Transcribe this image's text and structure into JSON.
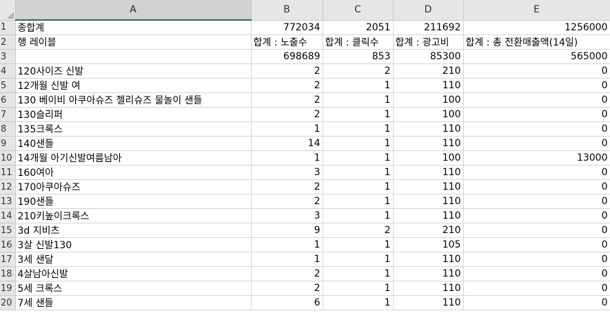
{
  "columns": [
    "A",
    "B",
    "C",
    "D",
    "E"
  ],
  "rows": [
    {
      "n": "1",
      "cells": [
        "종합계",
        "772034",
        "2051",
        "211692",
        "1256000"
      ]
    },
    {
      "n": "2",
      "cells": [
        "행 레이블",
        "합계 : 노출수",
        "합계 : 클릭수",
        "합계 : 광고비",
        "합계 : 총 전환매출액(14일)"
      ]
    },
    {
      "n": "3",
      "cells": [
        "",
        "698689",
        "853",
        "85300",
        "565000"
      ]
    },
    {
      "n": "4",
      "cells": [
        "120사이즈 신발",
        "2",
        "2",
        "210",
        "0"
      ]
    },
    {
      "n": "5",
      "cells": [
        "12개월 신발 여",
        "2",
        "1",
        "110",
        "0"
      ]
    },
    {
      "n": "6",
      "cells": [
        "130 베이비 아쿠아슈즈 젤리슈즈 물놀이 샌들",
        "2",
        "1",
        "100",
        "0"
      ]
    },
    {
      "n": "7",
      "cells": [
        "130슬리퍼",
        "2",
        "1",
        "100",
        "0"
      ]
    },
    {
      "n": "8",
      "cells": [
        "135크록스",
        "1",
        "1",
        "110",
        "0"
      ]
    },
    {
      "n": "9",
      "cells": [
        "140샌들",
        "14",
        "1",
        "110",
        "0"
      ]
    },
    {
      "n": "10",
      "cells": [
        "14개월 아기신발여름남아",
        "1",
        "1",
        "100",
        "13000"
      ]
    },
    {
      "n": "11",
      "cells": [
        "160여아",
        "3",
        "1",
        "110",
        "0"
      ]
    },
    {
      "n": "12",
      "cells": [
        "170아쿠아슈즈",
        "2",
        "1",
        "110",
        "0"
      ]
    },
    {
      "n": "13",
      "cells": [
        "190샌들",
        "2",
        "1",
        "110",
        "0"
      ]
    },
    {
      "n": "14",
      "cells": [
        "210키높이크록스",
        "3",
        "1",
        "110",
        "0"
      ]
    },
    {
      "n": "15",
      "cells": [
        "3d 지비츠",
        "9",
        "2",
        "210",
        "0"
      ]
    },
    {
      "n": "16",
      "cells": [
        "3살 신발130",
        "1",
        "1",
        "105",
        "0"
      ]
    },
    {
      "n": "17",
      "cells": [
        "3세 샌달",
        "1",
        "1",
        "110",
        "0"
      ]
    },
    {
      "n": "18",
      "cells": [
        "4살남아신발",
        "2",
        "1",
        "110",
        "0"
      ]
    },
    {
      "n": "19",
      "cells": [
        "5세 크록스",
        "2",
        "1",
        "110",
        "0"
      ]
    },
    {
      "n": "20",
      "cells": [
        "7세 샌들",
        "6",
        "1",
        "110",
        "0"
      ]
    }
  ]
}
